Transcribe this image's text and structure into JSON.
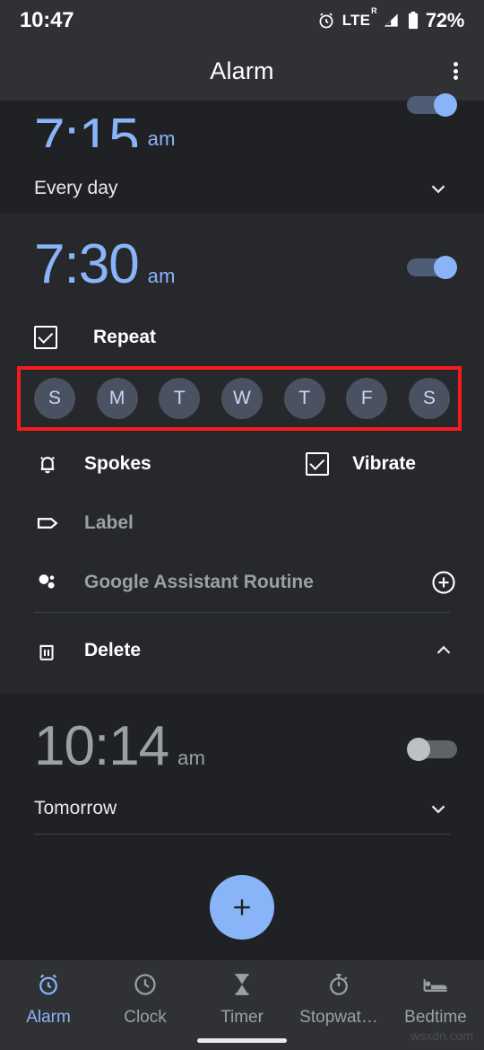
{
  "status_bar": {
    "time": "10:47",
    "network": "LTE",
    "network_sup": "R",
    "battery": "72%",
    "icons": [
      "alarm-icon",
      "signal-icon",
      "battery-icon"
    ]
  },
  "app_bar": {
    "title": "Alarm",
    "overflow_label": "More options"
  },
  "alarms": [
    {
      "time": "7:15",
      "ampm": "am",
      "schedule": "Every day",
      "enabled": true,
      "expanded": false,
      "clipped": true
    },
    {
      "time": "7:30",
      "ampm": "am",
      "enabled": true,
      "expanded": true,
      "repeat": {
        "label": "Repeat",
        "checked": true
      },
      "days": [
        {
          "letter": "S",
          "name": "Sunday",
          "selected": false
        },
        {
          "letter": "M",
          "name": "Monday",
          "selected": false
        },
        {
          "letter": "T",
          "name": "Tuesday",
          "selected": false
        },
        {
          "letter": "W",
          "name": "Wednesday",
          "selected": false
        },
        {
          "letter": "T",
          "name": "Thursday",
          "selected": false
        },
        {
          "letter": "F",
          "name": "Friday",
          "selected": false
        },
        {
          "letter": "S",
          "name": "Saturday",
          "selected": false
        }
      ],
      "ringtone": {
        "label": "Spokes",
        "icon": "bell-icon"
      },
      "vibrate": {
        "label": "Vibrate",
        "checked": true
      },
      "alarm_label": {
        "label": "Label",
        "icon": "tag-icon"
      },
      "assistant_routine": {
        "label": "Google Assistant Routine",
        "icon": "google-assistant-icon",
        "action": "add"
      },
      "delete": {
        "label": "Delete",
        "icon": "trash-icon"
      }
    },
    {
      "time": "10:14",
      "ampm": "am",
      "schedule": "Tomorrow",
      "enabled": false,
      "expanded": false
    }
  ],
  "highlight": {
    "color": "#f71b20",
    "target": "day-selector-row"
  },
  "fab": {
    "label": "+",
    "name": "add-alarm-button",
    "color": "#8ab4f8"
  },
  "bottom_nav": {
    "active_index": 0,
    "items": [
      {
        "label": "Alarm",
        "icon": "alarm-clock-icon"
      },
      {
        "label": "Clock",
        "icon": "clock-icon"
      },
      {
        "label": "Timer",
        "icon": "hourglass-icon"
      },
      {
        "label": "Stopwat…",
        "icon": "stopwatch-icon"
      },
      {
        "label": "Bedtime",
        "icon": "bed-icon"
      }
    ]
  },
  "watermark": "wsxdn.com",
  "theme": {
    "accent": "#8ab4f8",
    "background": "#202124",
    "surface": "#303134",
    "expanded_surface": "#26282b",
    "muted_text": "#9aa0a6"
  }
}
